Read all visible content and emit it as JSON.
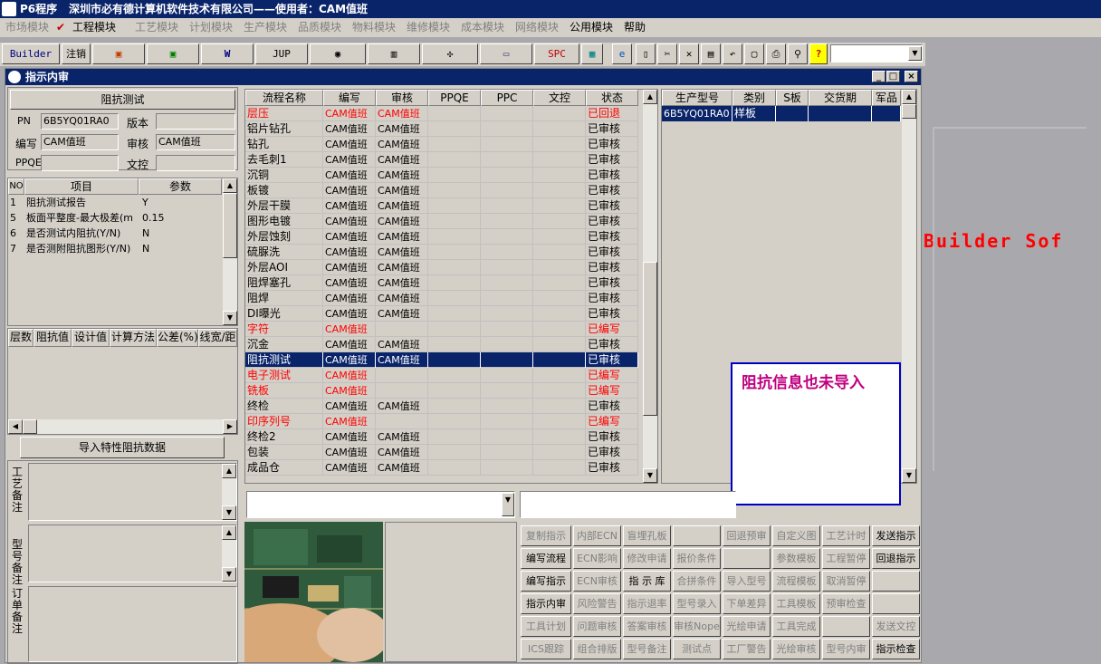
{
  "app": {
    "title": "P6程序",
    "company": "深圳市必有德计算机软件技术有限公司——使用者：CAM值班"
  },
  "menu": [
    "市场模块",
    "工程模块",
    "工艺模块",
    "计划模块",
    "生产模块",
    "品质模块",
    "物料模块",
    "维修模块",
    "成本模块",
    "网络模块",
    "公用模块",
    "帮助"
  ],
  "toolbar": {
    "builder": "Builder",
    "logout": "注销",
    "jup": "JUP",
    "spc": "SPC"
  },
  "child": {
    "title": "指示内审"
  },
  "left": {
    "section_title": "阻抗测试",
    "pn_label": "PN",
    "pn_value": "6B5YQ01RA0",
    "ver_label": "版本",
    "ver_value": "",
    "edit_label": "编写",
    "edit_value": "CAM值班",
    "audit_label": "审核",
    "audit_value": "CAM值班",
    "ppqe_label": "PPQE",
    "ppqe_value": "",
    "doc_label": "文控",
    "doc_value": "",
    "param_headers": [
      "NO",
      "项目",
      "参数"
    ],
    "params": [
      {
        "no": "1",
        "item": "阻抗测试报告",
        "val": "Y"
      },
      {
        "no": "5",
        "item": "板面平整度-最大极差(m",
        "val": "0.15"
      },
      {
        "no": "6",
        "item": "是否测试内阻抗(Y/N)",
        "val": "N"
      },
      {
        "no": "7",
        "item": "是否测附阻抗图形(Y/N)",
        "val": "N"
      }
    ],
    "imp_headers": [
      "层数",
      "阻抗值",
      "设计值",
      "计算方法",
      "公差(%)",
      "线宽/距"
    ],
    "import_btn": "导入特性阻抗数据",
    "note1": "工艺备注",
    "note2": "型号备注",
    "note3": "订单备注"
  },
  "flow": {
    "headers": [
      "流程名称",
      "编写",
      "审核",
      "PPQE",
      "PPC",
      "文控",
      "状态"
    ],
    "rows": [
      {
        "name": "层压",
        "edit": "CAM值班",
        "audit": "CAM值班",
        "status": "已回退",
        "red": true
      },
      {
        "name": "铝片钻孔",
        "edit": "CAM值班",
        "audit": "CAM值班",
        "status": "已审核",
        "red": false
      },
      {
        "name": "钻孔",
        "edit": "CAM值班",
        "audit": "CAM值班",
        "status": "已审核",
        "red": false
      },
      {
        "name": "去毛刺1",
        "edit": "CAM值班",
        "audit": "CAM值班",
        "status": "已审核",
        "red": false
      },
      {
        "name": "沉铜",
        "edit": "CAM值班",
        "audit": "CAM值班",
        "status": "已审核",
        "red": false
      },
      {
        "name": "板镀",
        "edit": "CAM值班",
        "audit": "CAM值班",
        "status": "已审核",
        "red": false
      },
      {
        "name": "外层干膜",
        "edit": "CAM值班",
        "audit": "CAM值班",
        "status": "已审核",
        "red": false
      },
      {
        "name": "图形电镀",
        "edit": "CAM值班",
        "audit": "CAM值班",
        "status": "已审核",
        "red": false
      },
      {
        "name": "外层蚀刻",
        "edit": "CAM值班",
        "audit": "CAM值班",
        "status": "已审核",
        "red": false
      },
      {
        "name": "硫脲洗",
        "edit": "CAM值班",
        "audit": "CAM值班",
        "status": "已审核",
        "red": false
      },
      {
        "name": "外层AOI",
        "edit": "CAM值班",
        "audit": "CAM值班",
        "status": "已审核",
        "red": false
      },
      {
        "name": "阻焊塞孔",
        "edit": "CAM值班",
        "audit": "CAM值班",
        "status": "已审核",
        "red": false
      },
      {
        "name": "阻焊",
        "edit": "CAM值班",
        "audit": "CAM值班",
        "status": "已审核",
        "red": false
      },
      {
        "name": "DI曝光",
        "edit": "CAM值班",
        "audit": "CAM值班",
        "status": "已审核",
        "red": false
      },
      {
        "name": "字符",
        "edit": "CAM值班",
        "audit": "",
        "status": "已编写",
        "red": true
      },
      {
        "name": "沉金",
        "edit": "CAM值班",
        "audit": "CAM值班",
        "status": "已审核",
        "red": false
      },
      {
        "name": "阻抗测试",
        "edit": "CAM值班",
        "audit": "CAM值班",
        "status": "已审核",
        "red": false,
        "selected": true
      },
      {
        "name": "电子测试",
        "edit": "CAM值班",
        "audit": "",
        "status": "已编写",
        "red": true
      },
      {
        "name": "铣板",
        "edit": "CAM值班",
        "audit": "",
        "status": "已编写",
        "red": true
      },
      {
        "name": "终检",
        "edit": "CAM值班",
        "audit": "CAM值班",
        "status": "已审核",
        "red": false
      },
      {
        "name": "印序列号",
        "edit": "CAM值班",
        "audit": "",
        "status": "已编写",
        "red": true
      },
      {
        "name": "终检2",
        "edit": "CAM值班",
        "audit": "CAM值班",
        "status": "已审核",
        "red": false
      },
      {
        "name": "包装",
        "edit": "CAM值班",
        "audit": "CAM值班",
        "status": "已审核",
        "red": false
      },
      {
        "name": "成品仓",
        "edit": "CAM值班",
        "audit": "CAM值班",
        "status": "已审核",
        "red": false
      }
    ]
  },
  "prod": {
    "headers": [
      "生产型号",
      "类别",
      "S板",
      "交货期",
      "军品"
    ],
    "rows": [
      {
        "model": "6B5YQ01RA0",
        "type": "样板",
        "s": "",
        "date": "",
        "mil": ""
      }
    ]
  },
  "annotation": "阻抗信息也未导入",
  "background_text": "Builder Sof",
  "buttons": [
    [
      {
        "t": "复制指示",
        "g": true
      },
      {
        "t": "内部ECN",
        "g": true
      },
      {
        "t": "盲埋孔板",
        "g": true
      },
      {
        "t": "",
        "g": true
      },
      {
        "t": "回退预审",
        "g": true
      },
      {
        "t": "自定义图",
        "g": true
      },
      {
        "t": "工艺计时",
        "g": true
      },
      {
        "t": "发送指示",
        "g": false
      }
    ],
    [
      {
        "t": "编写流程",
        "g": false
      },
      {
        "t": "ECN影响",
        "g": true
      },
      {
        "t": "修改申请",
        "g": true
      },
      {
        "t": "报价条件",
        "g": true
      },
      {
        "t": "",
        "g": true
      },
      {
        "t": "参数模板",
        "g": true
      },
      {
        "t": "工程暂停",
        "g": true
      },
      {
        "t": "回退指示",
        "g": false
      }
    ],
    [
      {
        "t": "编写指示",
        "g": false
      },
      {
        "t": "ECN审核",
        "g": true
      },
      {
        "t": "指 示 库",
        "g": false
      },
      {
        "t": "合拼条件",
        "g": true
      },
      {
        "t": "导入型号",
        "g": true
      },
      {
        "t": "流程模板",
        "g": true
      },
      {
        "t": "取消暂停",
        "g": true
      },
      {
        "t": "",
        "g": true
      }
    ],
    [
      {
        "t": "指示内审",
        "g": false
      },
      {
        "t": "风险警告",
        "g": true
      },
      {
        "t": "指示退率",
        "g": true
      },
      {
        "t": "型号录入",
        "g": true
      },
      {
        "t": "下单差异",
        "g": true
      },
      {
        "t": "工具模板",
        "g": true
      },
      {
        "t": "预审检查",
        "g": true
      },
      {
        "t": "",
        "g": true
      }
    ],
    [
      {
        "t": "工具计划",
        "g": true
      },
      {
        "t": "问题审核",
        "g": true
      },
      {
        "t": "答案审核",
        "g": true
      },
      {
        "t": "审核Nope",
        "g": true
      },
      {
        "t": "光绘申请",
        "g": true
      },
      {
        "t": "工具完成",
        "g": true
      },
      {
        "t": "",
        "g": true
      },
      {
        "t": "发送文控",
        "g": true
      }
    ],
    [
      {
        "t": "ICS跟踪",
        "g": true
      },
      {
        "t": "组合排版",
        "g": true
      },
      {
        "t": "型号备注",
        "g": true
      },
      {
        "t": "测试点",
        "g": true
      },
      {
        "t": "工厂警告",
        "g": true
      },
      {
        "t": "光绘审核",
        "g": true
      },
      {
        "t": "型号内审",
        "g": true
      },
      {
        "t": "指示检查",
        "g": false
      }
    ]
  ]
}
